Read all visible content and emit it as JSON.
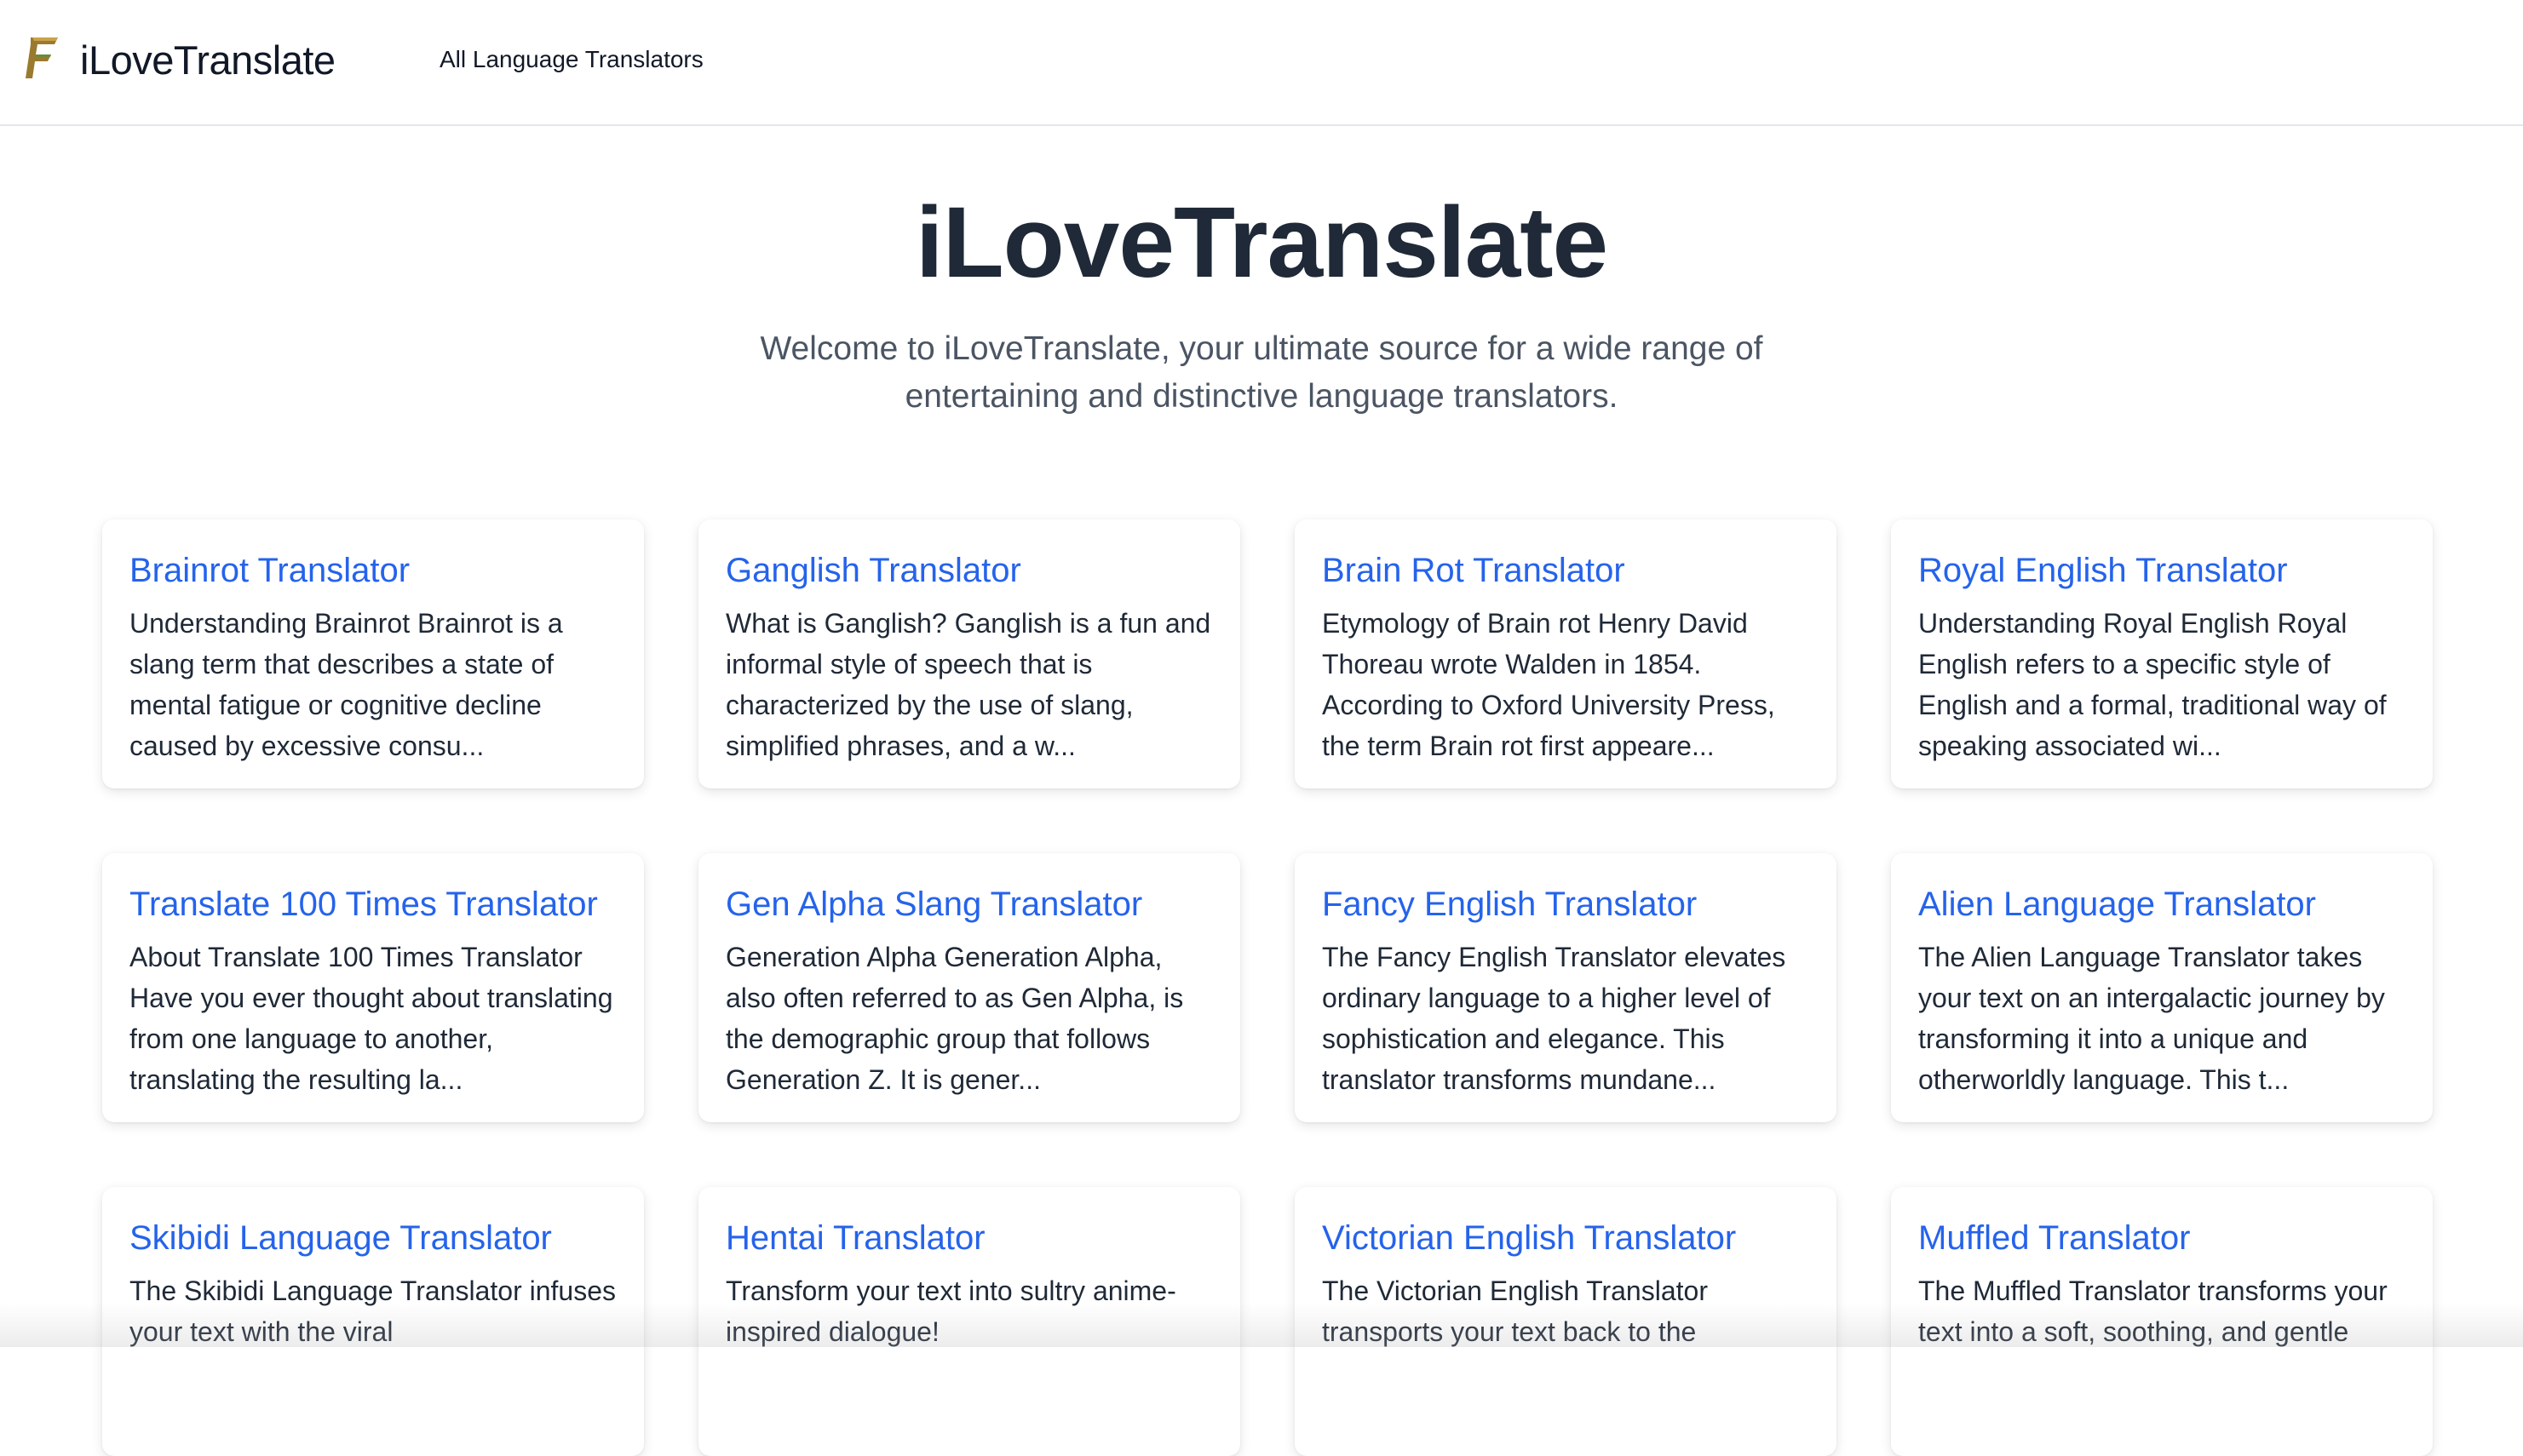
{
  "header": {
    "logo_icon": "stylized-f-logo-icon",
    "logo_color": "#9a7a2e",
    "brand_name": "iLoveTranslate",
    "nav_link": "All Language Translators"
  },
  "hero": {
    "title": "iLoveTranslate",
    "subtitle": "Welcome to iLoveTranslate, your ultimate source for a wide range of entertaining and distinctive language translators."
  },
  "colors": {
    "link": "#2563eb",
    "text": "#1f2937",
    "muted": "#4b5563"
  },
  "translators": [
    {
      "title": "Brainrot Translator",
      "description": "Understanding Brainrot Brainrot is a slang term that describes a state of mental fatigue or cognitive decline caused by excessive consu..."
    },
    {
      "title": "Ganglish Translator",
      "description": "What is Ganglish? Ganglish is a fun and informal style of speech that is characterized by the use of slang, simplified phrases, and a w..."
    },
    {
      "title": "Brain Rot Translator",
      "description": "Etymology of Brain rot Henry David Thoreau wrote Walden in 1854. According to Oxford University Press, the term Brain rot first appeare..."
    },
    {
      "title": "Royal English Translator",
      "description": "Understanding Royal English Royal English refers to a specific style of English and a formal, traditional way of speaking associated wi..."
    },
    {
      "title": "Translate 100 Times Translator",
      "description": "About Translate 100 Times Translator Have you ever thought about translating from one language to another, translating the resulting la..."
    },
    {
      "title": "Gen Alpha Slang Translator",
      "description": "Generation Alpha Generation Alpha, also often referred to as Gen Alpha, is the demographic group that follows Generation Z. It is gener..."
    },
    {
      "title": "Fancy English Translator",
      "description": "The Fancy English Translator elevates ordinary language to a higher level of sophistication and elegance. This translator transforms mundane..."
    },
    {
      "title": "Alien Language Translator",
      "description": "The Alien Language Translator takes your text on an intergalactic journey by transforming it into a unique and otherworldly language. This t..."
    },
    {
      "title": "Skibidi Language Translator",
      "description": "The Skibidi Language Translator infuses your text with the viral"
    },
    {
      "title": "Hentai Translator",
      "description": "Transform your text into sultry anime-inspired dialogue!"
    },
    {
      "title": "Victorian English Translator",
      "description": "The Victorian English Translator transports your text back to the"
    },
    {
      "title": "Muffled Translator",
      "description": "The Muffled Translator transforms your text into a soft, soothing, and gentle"
    }
  ]
}
